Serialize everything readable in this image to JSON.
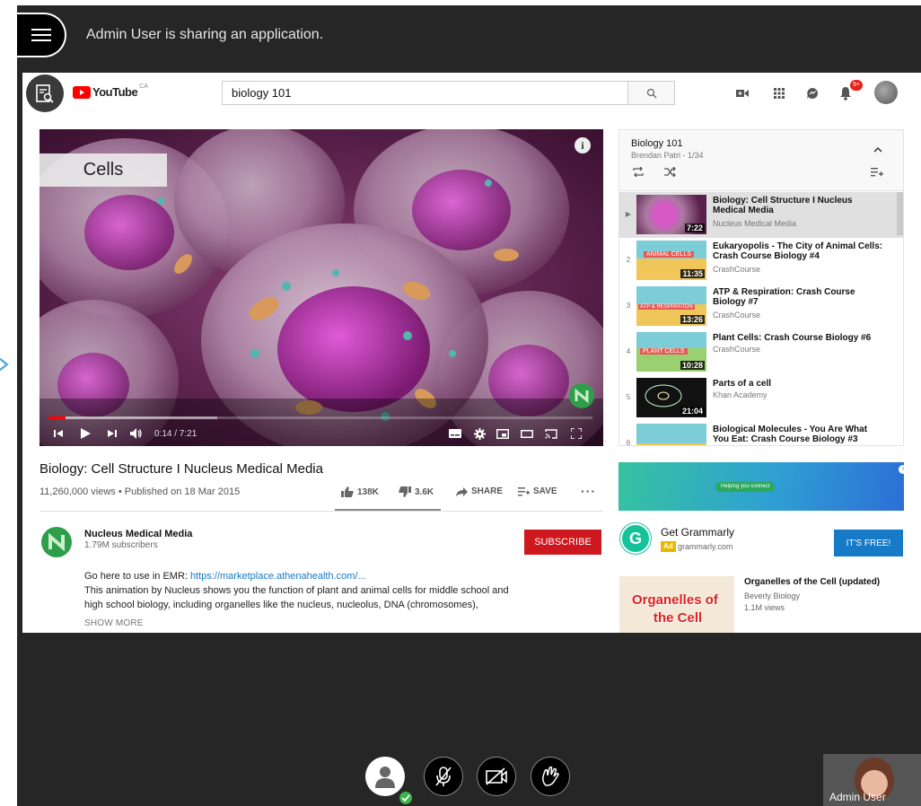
{
  "session": {
    "share_message": "Admin User is sharing an application.",
    "self_name": "Admin User"
  },
  "youtube": {
    "logo_text": "YouTube",
    "region": "CA",
    "search_value": "biology 101",
    "notification_count": "9+"
  },
  "video": {
    "overlay_label": "Cells",
    "time": "0:14 / 7:21",
    "progress_percent": 3.2,
    "buffered_percent": 31,
    "title": "Biology: Cell Structure I Nucleus Medical Media",
    "stats": "11,260,000 views • Published on 18 Mar 2015",
    "likes": "138K",
    "dislikes": "3.6K",
    "share_label": "SHARE",
    "save_label": "SAVE",
    "channel": {
      "name": "Nucleus Medical Media",
      "subscribers": "1.79M subscribers",
      "subscribe_label": "SUBSCRIBE"
    },
    "description": {
      "line1_prefix": "Go here to use in EMR: ",
      "line1_link": "https://marketplace.athenahealth.com/...",
      "line2": "This animation by Nucleus shows you the function of plant and animal cells for middle school and",
      "line3": "high school biology, including organelles like the nucleus, nucleolus, DNA (chromosomes),",
      "show_more": "SHOW MORE"
    }
  },
  "playlist": {
    "title": "Biology 101",
    "subtitle": "Brendan Patri - 1/34",
    "items": [
      {
        "index": "▶",
        "title": "Biology: Cell Structure I Nucleus Medical Media",
        "channel": "Nucleus Medical Media",
        "duration": "7:22",
        "thumb_label": ""
      },
      {
        "index": "2",
        "title": "Eukaryopolis - The City of Animal Cells: Crash Course Biology #4",
        "channel": "CrashCourse",
        "duration": "11:35",
        "thumb_label": "ANIMAL CELLS"
      },
      {
        "index": "3",
        "title": "ATP & Respiration: Crash Course Biology #7",
        "channel": "CrashCourse",
        "duration": "13:26",
        "thumb_label": "ATP & RESPIRATION"
      },
      {
        "index": "4",
        "title": "Plant Cells: Crash Course Biology #6",
        "channel": "CrashCourse",
        "duration": "10:28",
        "thumb_label": "PLANT CELLS"
      },
      {
        "index": "5",
        "title": "Parts of a cell",
        "channel": "Khan Academy",
        "duration": "21:04",
        "thumb_label": ""
      },
      {
        "index": "6",
        "title": "Biological Molecules - You Are What You Eat: Crash Course Biology #3",
        "channel": "",
        "duration": "",
        "thumb_label": ""
      }
    ]
  },
  "ad": {
    "banner_text": "Helping you connect",
    "title": "Get Grammarly",
    "badge": "Ad",
    "domain": "grammarly.com",
    "cta": "IT'S FREE!"
  },
  "recommended": {
    "title": "Organelles of the Cell (updated)",
    "channel": "Beverly Biology",
    "views": "1.1M views",
    "thumb_line1": "Organelles of",
    "thumb_line2": "the Cell"
  },
  "colors": {
    "youtube_red": "#ff0000",
    "subscribe_red": "#cc181e",
    "link_blue": "#167ac6",
    "collab_bg": "#262626",
    "status_green": "#39b54a"
  }
}
